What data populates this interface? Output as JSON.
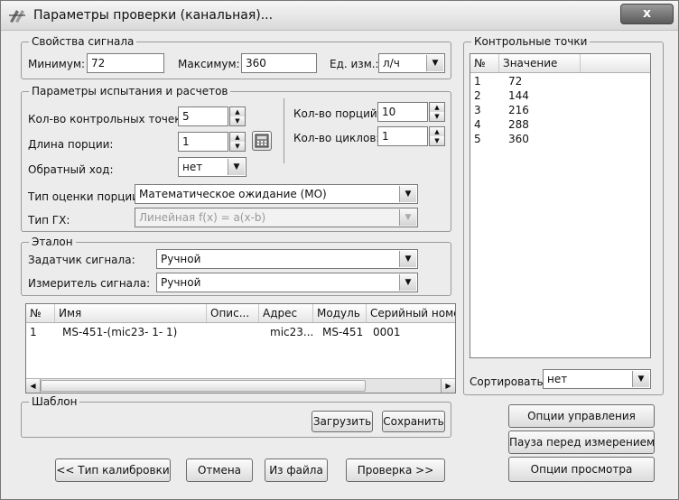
{
  "window": {
    "title": "Параметры проверки (канальная)...",
    "close_label": "x"
  },
  "signal_props": {
    "legend": "Свойства сигнала",
    "min_label": "Минимум:",
    "min_value": "72",
    "max_label": "Максимум:",
    "max_value": "360",
    "unit_label": "Ед. изм.:",
    "unit_value": "л/ч"
  },
  "test_params": {
    "legend": "Параметры испытания и расчетов",
    "points_label": "Кол-во контрольных точек:",
    "points_value": "5",
    "portion_len_label": "Длина порции:",
    "portion_len_value": "1",
    "reverse_label": "Обратный ход:",
    "reverse_value": "нет",
    "portions_label": "Кол-во порций:",
    "portions_value": "10",
    "cycles_label": "Кол-во циклов:",
    "cycles_value": "1",
    "estimate_label": "Тип оценки порции:",
    "estimate_value": "Математическое ожидание (МО)",
    "gx_label": "Тип ГХ:",
    "gx_value": "Линейная f(x) = a(x-b)"
  },
  "etalon": {
    "legend": "Эталон",
    "setter_label": "Задатчик сигнала:",
    "setter_value": "Ручной",
    "meter_label": "Измеритель сигнала:",
    "meter_value": "Ручной"
  },
  "devices": {
    "columns": [
      "№",
      "Имя",
      "Опис...",
      "Адрес",
      "Модуль",
      "Серийный номе"
    ],
    "rows": [
      [
        "1",
        "MS-451-(mic23- 1- 1)",
        "",
        "mic23...",
        "MS-451",
        "0001"
      ]
    ]
  },
  "template": {
    "legend": "Шаблон",
    "load_label": "Загрузить",
    "save_label": "Сохранить"
  },
  "control_points": {
    "legend": "Контрольные точки",
    "columns": [
      "№",
      "Значение"
    ],
    "rows": [
      [
        "1",
        "72"
      ],
      [
        "2",
        "144"
      ],
      [
        "3",
        "216"
      ],
      [
        "4",
        "288"
      ],
      [
        "5",
        "360"
      ]
    ],
    "sort_label": "Сортировать",
    "sort_value": "нет"
  },
  "right_buttons": {
    "control_options": "Опции управления",
    "pause": "Пауза перед измерением",
    "view_options": "Опции просмотра"
  },
  "bottom_buttons": {
    "back": "<< Тип калибровки",
    "cancel": "Отмена",
    "from_file": "Из файла",
    "check": "Проверка >>"
  }
}
